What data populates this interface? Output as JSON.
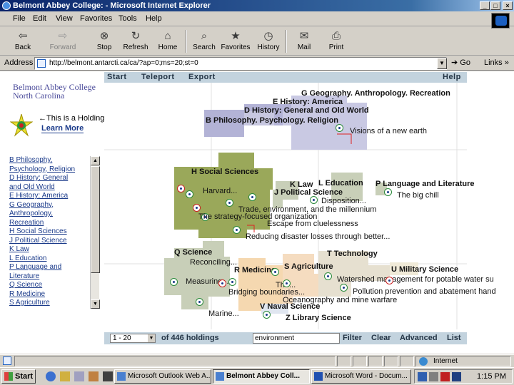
{
  "window": {
    "title": "Belmont Abbey College: - Microsoft Internet Explorer",
    "buttons": {
      "minimize": "_",
      "maximize": "□",
      "close": "×"
    }
  },
  "menu": [
    "File",
    "Edit",
    "View",
    "Favorites",
    "Tools",
    "Help"
  ],
  "toolbar": {
    "back": "Back",
    "forward": "Forward",
    "stop": "Stop",
    "refresh": "Refresh",
    "home": "Home",
    "search": "Search",
    "favorites": "Favorites",
    "history": "History",
    "mail": "Mail",
    "print": "Print"
  },
  "address": {
    "label": "Address",
    "url": "http://belmont.antarcti.ca/ca/?ap=0;ms=20;st=0",
    "go": "Go",
    "links": "Links"
  },
  "site": {
    "nav": [
      "Start",
      "Teleport",
      "Export",
      "Help"
    ],
    "logo_line1": "Belmont Abbey College",
    "logo_line2": "North Carolina",
    "holding_text": "This is a Holding",
    "learn_more": "Learn More"
  },
  "classes": [
    "B Philosophy,",
    "Psychology, Religion",
    "D History: General",
    "and Old World",
    "E History: America",
    "G Geography,",
    "Anthropology,",
    "Recreation",
    "H Social Sciences",
    "J Political Science",
    "K Law",
    "L Education",
    "P Language and",
    "Literature",
    "Q Science",
    "R Medicine",
    "S Agriculture"
  ],
  "map": {
    "regions": {
      "G": "G Geography. Anthropology. Recreation",
      "E": "E History: America",
      "D": "D History: General and Old World",
      "B": "B Philosophy. Psychology. Religion",
      "H": "H Social Sciences",
      "K": "K Law",
      "L": "L Education",
      "P": "P Language and Literature",
      "J": "J Political Science",
      "Q": "Q Science",
      "T": "T Technology",
      "R": "R Medicine",
      "S": "S Agriculture",
      "U": "U Military Science",
      "V": "V Naval Science",
      "Z": "Z Library Science"
    },
    "items": {
      "visions": "Visions of a new earth",
      "harvard": "Harvard...",
      "disposition": "Disposition...",
      "big_chill": "The big chill",
      "trade": "Trade, environment, and the millennium",
      "strategy": "The strategy-focused organization",
      "escape": "Escape from cluelessness",
      "disaster": "Reducing disaster losses through better...",
      "reconciling": "Reconciling...",
      "measuring": "Measuring...",
      "the": "The...",
      "bridging": "Bridging boundaries...",
      "watershed": "Watershed management for potable water su",
      "pollution": "Pollution prevention and abatement hand",
      "oceanography": "Oceanography and mine warfare",
      "marine": "Marine..."
    }
  },
  "bottom": {
    "range": "1 - 20",
    "count": "of 446 holdings",
    "search_value": "environment",
    "filter": "Filter",
    "clear": "Clear",
    "advanced": "Advanced",
    "list": "List"
  },
  "status": {
    "zone": "Internet"
  },
  "taskbar": {
    "start": "Start",
    "tasks": [
      "Microsoft Outlook Web A...",
      "Belmont Abbey Coll...",
      "Microsoft Word - Docum..."
    ],
    "clock": "1:15 PM"
  },
  "colors": {
    "titlebar": "#0a246a",
    "social_sciences": "#9aa85a",
    "philosophy": "#b8b8d8",
    "science": "#c8cfb8",
    "medicine": "#f5d8b0"
  }
}
